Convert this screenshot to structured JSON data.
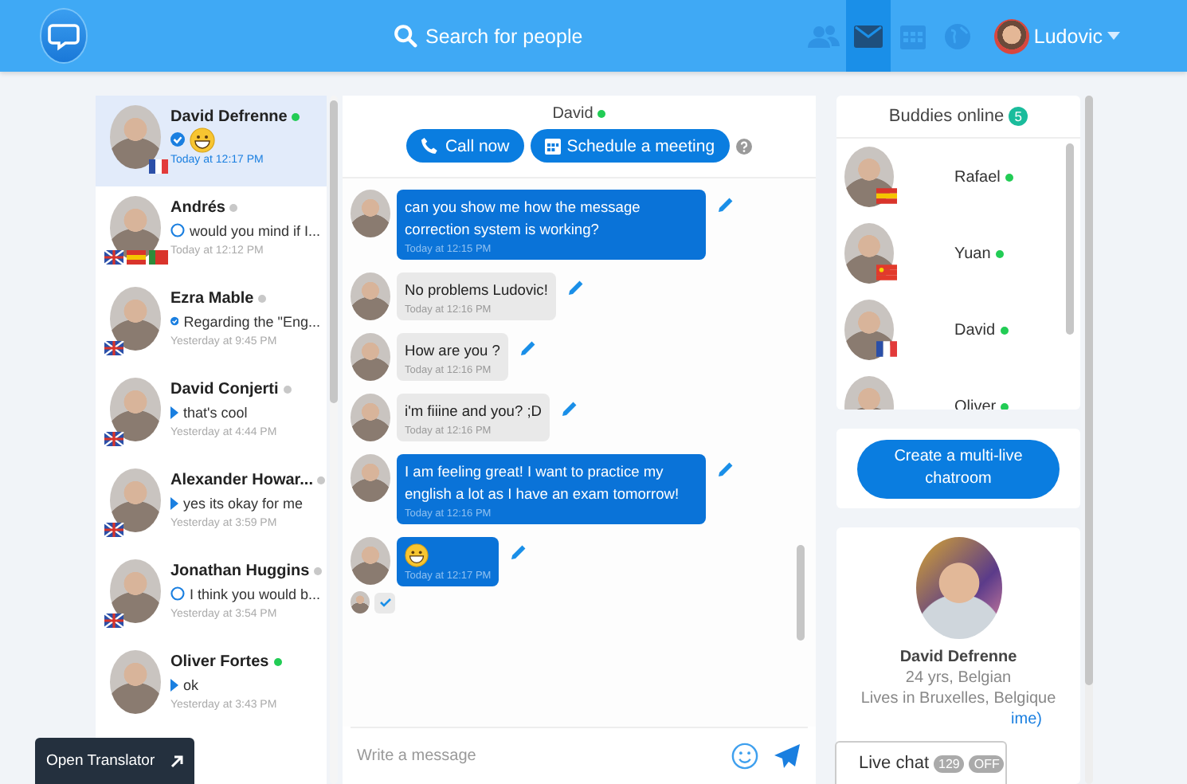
{
  "header": {
    "search_placeholder": "Search for people",
    "nav": [
      {
        "kind": "people",
        "selected": false
      },
      {
        "kind": "mail",
        "selected": true
      },
      {
        "kind": "calendar",
        "selected": false
      },
      {
        "kind": "globe",
        "selected": false
      }
    ],
    "user": "Ludovic"
  },
  "conversations": [
    {
      "name": "David Defrenne",
      "online": true,
      "kind": "seen",
      "preview_emoji": true,
      "time": "Today at 12:17 PM",
      "flags": [
        {
          "kind": "fr"
        }
      ],
      "selected": true
    },
    {
      "name": "Andrés",
      "online": false,
      "kind": "pending",
      "preview": "would you mind if I...",
      "time": "Today at 12:12 PM",
      "flags": [
        {
          "kind": "gb"
        },
        {
          "kind": "es"
        },
        {
          "kind": "pt"
        }
      ],
      "selected": false
    },
    {
      "name": "Ezra Mable",
      "online": false,
      "kind": "seen",
      "preview": "Regarding the \"Eng...",
      "time": "Yesterday at 9:45 PM",
      "flags": [
        {
          "kind": "gb"
        }
      ],
      "selected": false
    },
    {
      "name": "David Conjerti",
      "online": false,
      "kind": "sent",
      "preview": "that's cool",
      "time": "Yesterday at 4:44 PM",
      "flags": [
        {
          "kind": "gb"
        }
      ],
      "selected": false
    },
    {
      "name": "Alexander Howar...",
      "online": false,
      "kind": "sent",
      "preview": "yes its okay for me",
      "time": "Yesterday at 3:59 PM",
      "flags": [
        {
          "kind": "gb"
        }
      ],
      "selected": false
    },
    {
      "name": "Jonathan Huggins",
      "online": false,
      "kind": "pending",
      "preview": "I think you would b...",
      "time": "Yesterday at 3:54 PM",
      "flags": [
        {
          "kind": "gb"
        }
      ],
      "selected": false
    },
    {
      "name": "Oliver Fortes",
      "online": true,
      "kind": "sent",
      "preview": "ok",
      "time": "Yesterday at 3:43 PM",
      "selected": false
    }
  ],
  "chat": {
    "partner": "David",
    "online": true,
    "actions": [
      {
        "kind": "call",
        "label": "Call now"
      },
      {
        "kind": "calendar",
        "label": "Schedule a meeting"
      }
    ],
    "messages": [
      {
        "own": true,
        "kind": "text",
        "text": "can you show me how the message correction system is working?",
        "time": "Today at 12:15 PM"
      },
      {
        "own": false,
        "kind": "text",
        "text": "No problems Ludovic!",
        "time": "Today at 12:16 PM"
      },
      {
        "own": false,
        "kind": "text",
        "text": "How are you ?",
        "time": "Today at 12:16 PM"
      },
      {
        "own": false,
        "kind": "text",
        "text": "i'm fiiine and you? ;D",
        "time": "Today at 12:16 PM"
      },
      {
        "own": true,
        "kind": "text",
        "text": "I am feeling great! I want to practice my english a lot as I have an exam tomorrow!",
        "time": "Today at 12:16 PM"
      },
      {
        "own": true,
        "kind": "emoji",
        "time": "Today at 12:17 PM"
      }
    ],
    "seen": true,
    "input_placeholder": "Write a message"
  },
  "buddies": {
    "title": "Buddies online",
    "count": "5",
    "items": [
      {
        "name": "Rafael",
        "online": true,
        "flags": [
          {
            "kind": "es"
          }
        ]
      },
      {
        "name": "Yuan",
        "online": true,
        "flags": [
          {
            "kind": "cn"
          }
        ]
      },
      {
        "name": "David",
        "online": true,
        "flags": [
          {
            "kind": "fr"
          }
        ]
      },
      {
        "name": "Oliver",
        "online": true
      }
    ]
  },
  "create_button": "Create a multi-live chatroom",
  "profile": {
    "name": "David Defrenne",
    "details": "24 yrs, Belgian",
    "location": "Lives in Bruxelles, Belgique",
    "link": "ime)"
  },
  "translator_button": "Open Translator",
  "live_chat": {
    "label": "Live chat",
    "count": "129",
    "state": "OFF"
  }
}
